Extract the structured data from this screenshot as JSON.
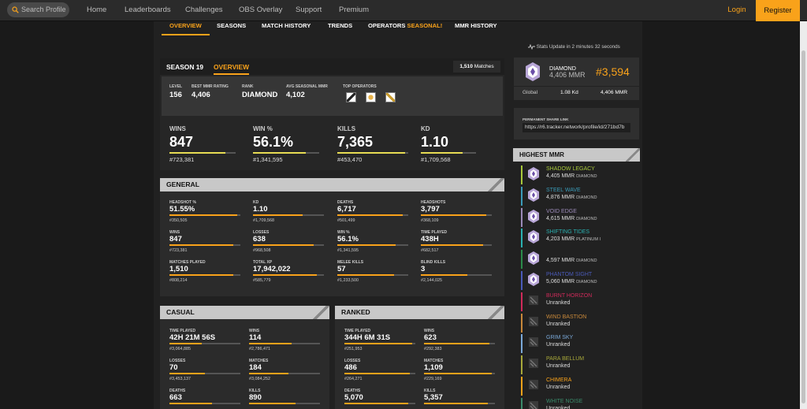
{
  "nav": {
    "search_placeholder": "Search Profile",
    "links": [
      "Home",
      "Leaderboards",
      "Challenges",
      "OBS Overlay",
      "Support",
      "Premium"
    ],
    "login": "Login",
    "register": "Register"
  },
  "subnav": {
    "tabs": [
      "OVERVIEW",
      "SEASONS",
      "MATCH HISTORY",
      "TRENDS",
      "OPERATORS",
      "MMR HISTORY"
    ],
    "seasonal": "SEASONAL!"
  },
  "season_panel": {
    "season": "SEASON 19",
    "tab": "OVERVIEW",
    "matches": "1,510",
    "matches_label": "Matches",
    "summary": [
      {
        "label": "Level",
        "value": "156"
      },
      {
        "label": "Best MMR Rating",
        "value": "4,406"
      },
      {
        "label": "Rank",
        "value": "DIAMOND"
      },
      {
        "label": "Avg Seasonal MMR",
        "value": "4,102"
      }
    ],
    "top_operators_label": "Top Operators",
    "big_stats": [
      {
        "label": "WINS",
        "value": "847",
        "rank": "#723,381",
        "fill": 0.85
      },
      {
        "label": "WIN %",
        "value": "56.1%",
        "rank": "#1,341,595",
        "fill": 0.8
      },
      {
        "label": "KILLS",
        "value": "7,365",
        "rank": "#453,470",
        "fill": 0.95
      },
      {
        "label": "KD",
        "value": "1.10",
        "rank": "#1,709,568",
        "fill": 0.75
      }
    ]
  },
  "general": {
    "title": "GENERAL",
    "stats": [
      {
        "label": "Headshot %",
        "value": "51.55%",
        "rank": "#350,505",
        "fill": 0.95
      },
      {
        "label": "KD",
        "value": "1.10",
        "rank": "#1,709,568",
        "fill": 0.7
      },
      {
        "label": "Deaths",
        "value": "6,717",
        "rank": "#501,499",
        "fill": 0.92
      },
      {
        "label": "Headshots",
        "value": "3,797",
        "rank": "#368,109",
        "fill": 0.92
      },
      {
        "label": "Wins",
        "value": "847",
        "rank": "#723,381",
        "fill": 0.9
      },
      {
        "label": "Losses",
        "value": "638",
        "rank": "#968,508",
        "fill": 0.86
      },
      {
        "label": "Win %",
        "value": "56.1%",
        "rank": "#1,341,595",
        "fill": 0.82
      },
      {
        "label": "Time Played",
        "value": "438H",
        "rank": "#682,517",
        "fill": 0.88
      },
      {
        "label": "Matches Played",
        "value": "1,510",
        "rank": "#808,214",
        "fill": 0.9
      },
      {
        "label": "Total XP",
        "value": "17,942,022",
        "rank": "#585,779",
        "fill": 0.9
      },
      {
        "label": "Melee Kills",
        "value": "57",
        "rank": "#1,233,500",
        "fill": 0.8
      },
      {
        "label": "Blind Kills",
        "value": "3",
        "rank": "#2,144,025",
        "fill": 0.65
      }
    ]
  },
  "casual": {
    "title": "CASUAL",
    "stats": [
      {
        "label": "Time Played",
        "value": "42H 21M 56S",
        "rank": "#3,064,885",
        "fill": 0.45
      },
      {
        "label": "Wins",
        "value": "114",
        "rank": "#2,786,471",
        "fill": 0.6
      },
      {
        "label": "Losses",
        "value": "70",
        "rank": "#3,453,137",
        "fill": 0.5
      },
      {
        "label": "Matches",
        "value": "184",
        "rank": "#3,084,252",
        "fill": 0.55
      },
      {
        "label": "Deaths",
        "value": "663",
        "rank": "",
        "fill": 0.6
      },
      {
        "label": "Kills",
        "value": "890",
        "rank": "",
        "fill": 0.65
      }
    ]
  },
  "ranked": {
    "title": "RANKED",
    "stats": [
      {
        "label": "Time Played",
        "value": "344H 6M 31S",
        "rank": "#251,953",
        "fill": 0.95
      },
      {
        "label": "Wins",
        "value": "623",
        "rank": "#292,383",
        "fill": 0.92
      },
      {
        "label": "Losses",
        "value": "486",
        "rank": "#264,271",
        "fill": 0.92
      },
      {
        "label": "Matches",
        "value": "1,109",
        "rank": "#229,169",
        "fill": 0.95
      },
      {
        "label": "Deaths",
        "value": "5,070",
        "rank": "",
        "fill": 0.9
      },
      {
        "label": "Kills",
        "value": "5,357",
        "rank": "",
        "fill": 0.9
      }
    ]
  },
  "sidebar": {
    "status": "Stats Update in 2 minutes 32 seconds",
    "rank_name": "DIAMOND",
    "rank_mmr": "4,406 MMR",
    "rank_position": "#3,594",
    "region": "Global",
    "region_kd": "1.08 Kd",
    "region_mmr": "4,406 MMR",
    "share_label": "Permanent Share Link",
    "share_url": "https://r6.tracker.network/profile/id/271bd7b"
  },
  "highest_mmr": {
    "title": "HIGHEST MMR",
    "seasons": [
      {
        "name": "SHADOW LEGACY",
        "mmr": "4,405 MMR",
        "rank": "DIAMOND",
        "color": "#a8c83a",
        "ranked": true
      },
      {
        "name": "STEEL WAVE",
        "mmr": "4,876 MMR",
        "rank": "DIAMOND",
        "color": "#3a9bb8",
        "ranked": true
      },
      {
        "name": "VOID EDGE",
        "mmr": "4,615 MMR",
        "rank": "DIAMOND",
        "color": "#9b8ab8",
        "ranked": true
      },
      {
        "name": "SHIFTING TIDES",
        "mmr": "4,203 MMR",
        "rank": "PLATINUM I",
        "color": "#2ab0b0",
        "ranked": true
      },
      {
        "name": "",
        "mmr": "4,597 MMR",
        "rank": "DIAMOND",
        "color": "#2a8a4a",
        "ranked": true
      },
      {
        "name": "PHANTOM SIGHT",
        "mmr": "5,060 MMR",
        "rank": "DIAMOND",
        "color": "#4a5ab8",
        "ranked": true
      },
      {
        "name": "BURNT HORIZON",
        "mmr": "Unranked",
        "rank": "",
        "color": "#d02a5a",
        "ranked": false
      },
      {
        "name": "WIND BASTION",
        "mmr": "Unranked",
        "rank": "",
        "color": "#c8883a",
        "ranked": false
      },
      {
        "name": "GRIM SKY",
        "mmr": "Unranked",
        "rank": "",
        "color": "#7aa8d8",
        "ranked": false
      },
      {
        "name": "PARA BELLUM",
        "mmr": "Unranked",
        "rank": "",
        "color": "#a8a83a",
        "ranked": false
      },
      {
        "name": "CHIMERA",
        "mmr": "Unranked",
        "rank": "",
        "color": "#f9a21a",
        "ranked": false
      },
      {
        "name": "WHITE NOISE",
        "mmr": "Unranked",
        "rank": "",
        "color": "#3a8a6a",
        "ranked": false
      }
    ]
  }
}
